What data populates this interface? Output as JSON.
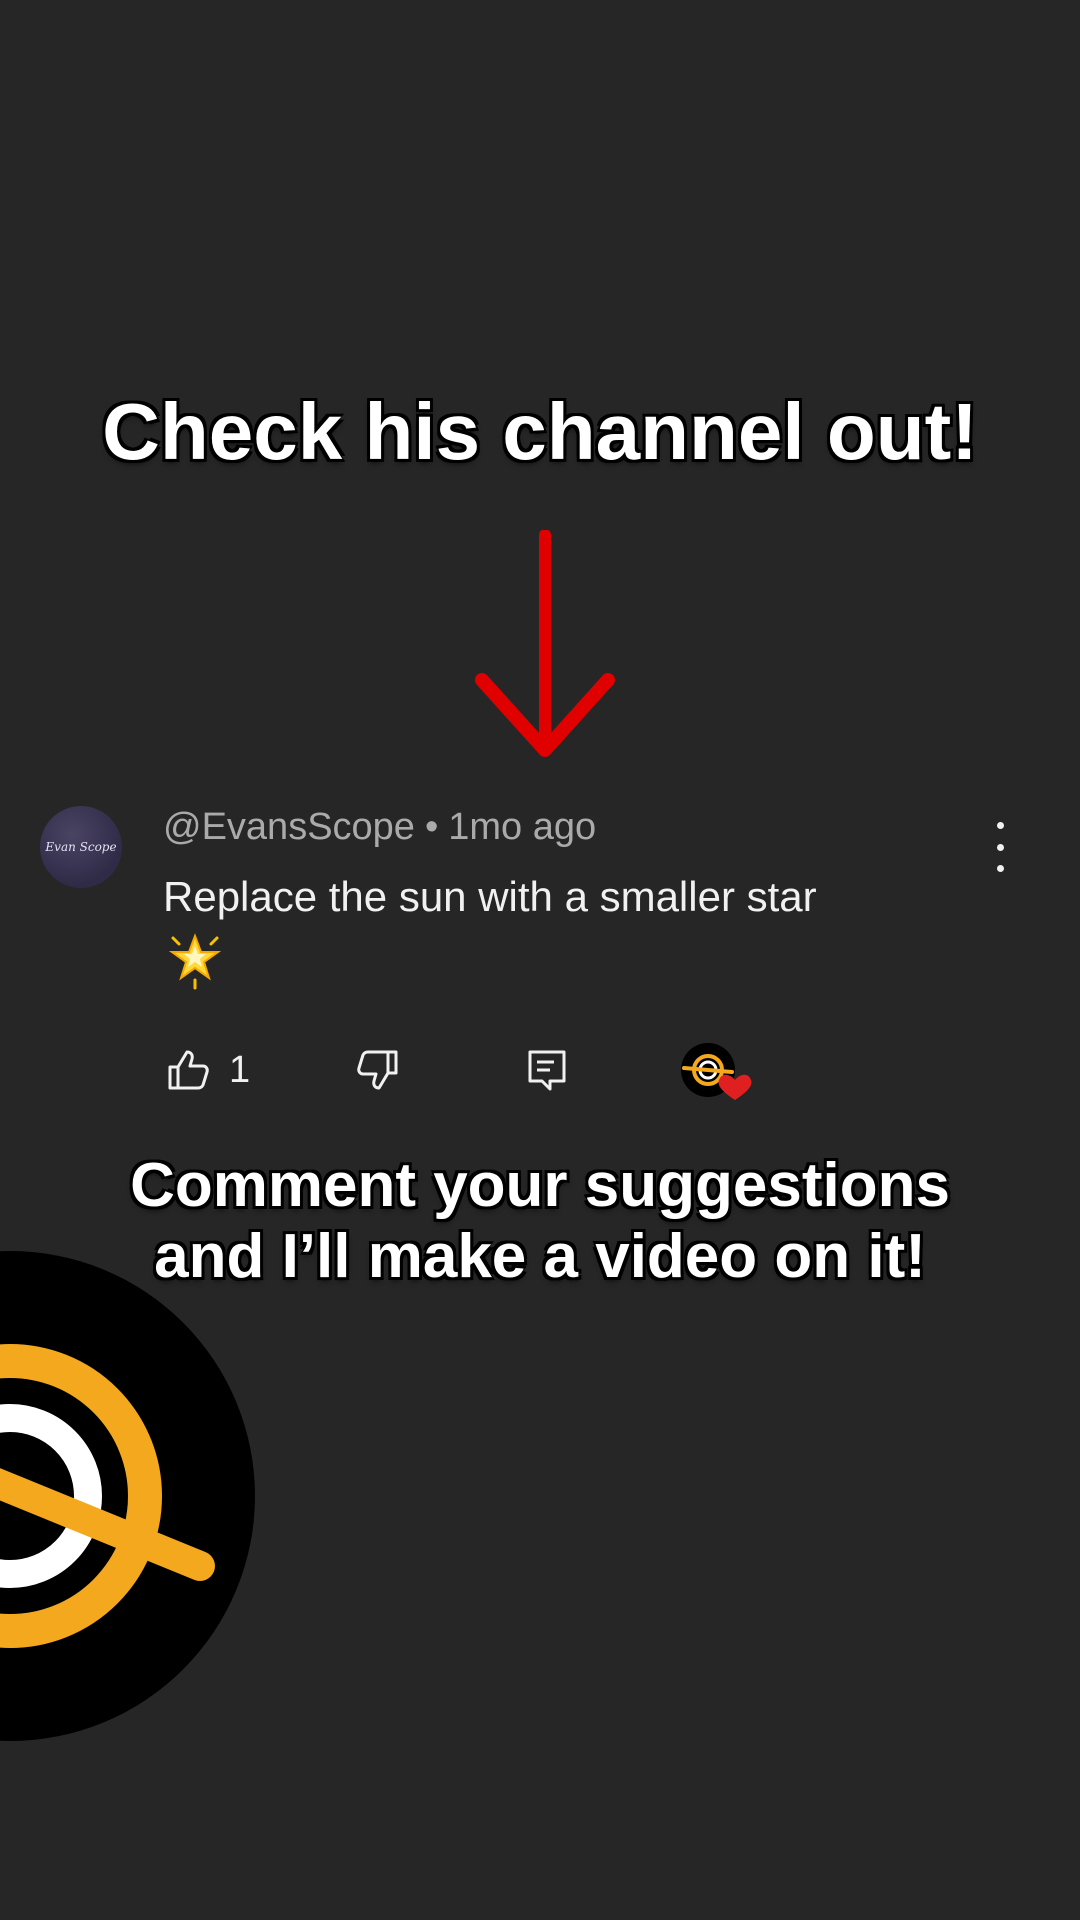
{
  "overlay": {
    "title": "Check his channel out!",
    "caption_line1": "Comment your suggestions",
    "caption_line2": "and I’ll make a video on it!"
  },
  "comment": {
    "avatar_text": "Evan Scope",
    "username": "@EvansScope",
    "separator": "•",
    "time": "1mo ago",
    "text": "Replace the sun with a smaller star",
    "emoji_icon": "glowing-star-icon",
    "like_count": "1",
    "icons": {
      "like": "thumb-up-icon",
      "dislike": "thumb-down-icon",
      "reply": "comment-icon",
      "more": "more-vert-icon",
      "creator_heart": "creator-heart-icon"
    }
  },
  "colors": {
    "background": "#262626",
    "arrow": "#e00000",
    "accent": "#f4a81d",
    "heart": "#e02020"
  }
}
